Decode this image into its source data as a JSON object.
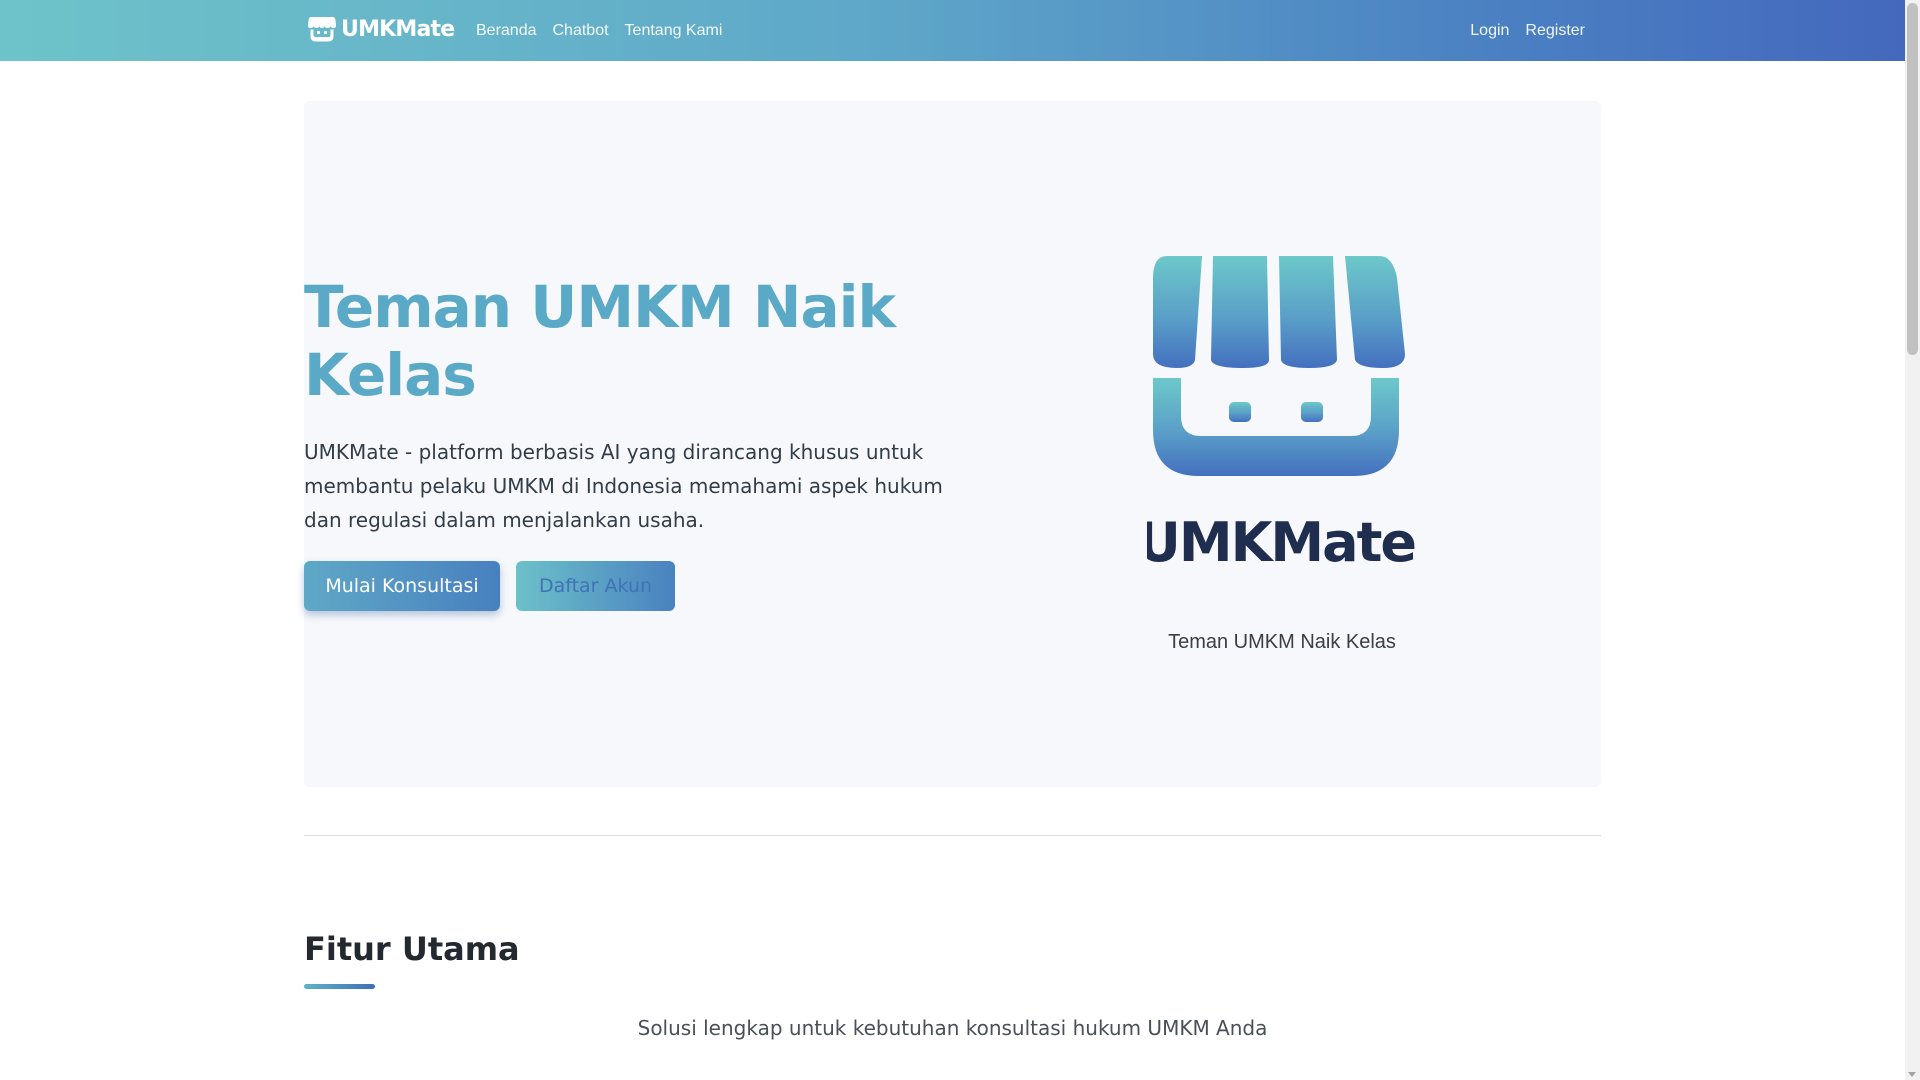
{
  "navbar": {
    "brand": "UMKMate",
    "links": [
      {
        "label": "Beranda"
      },
      {
        "label": "Chatbot"
      },
      {
        "label": "Tentang Kami"
      }
    ],
    "login": "Login",
    "register": "Register",
    "colors": {
      "gradient_start": "#6ec3c9",
      "gradient_end": "#4468bd"
    }
  },
  "hero": {
    "title": "Teman UMKM Naik Kelas",
    "description": "UMKMate - platform berbasis AI yang dirancang khusus untuk membantu pelaku UMKM di Indonesia memahami aspek hukum dan regulasi dalam menjalankan usaha.",
    "primary_button": "Mulai Konsultasi",
    "secondary_button": "Daftar Akun",
    "logo_text": "UMKMate",
    "tagline": "Teman UMKM Naik Kelas",
    "logo_icon": "storefront-icon",
    "colors": {
      "accent": "#5aa9c6",
      "logo_text": "#1f2d4f"
    }
  },
  "features": {
    "title": "Fitur Utama",
    "subtitle": "Solusi lengkap untuk kebutuhan konsultasi hukum UMKM Anda"
  }
}
